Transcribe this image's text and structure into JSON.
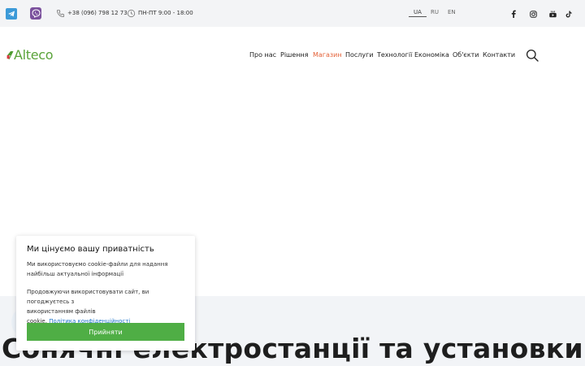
{
  "topbar": {
    "phone": "+38 (096) 798 12 73",
    "hours": "ПН-ПТ 9:00 - 18:00",
    "languages": [
      {
        "code": "UA",
        "active": true
      },
      {
        "code": "RU",
        "active": false
      },
      {
        "code": "EN",
        "active": false
      }
    ],
    "icons": {
      "messengers": [
        "telegram-icon",
        "viber-icon"
      ],
      "info": [
        "phone-icon",
        "clock-icon"
      ],
      "social": [
        "facebook-icon",
        "instagram-icon",
        "youtube-icon",
        "tiktok-icon"
      ]
    }
  },
  "header": {
    "logo_text": "Alteco",
    "nav": [
      {
        "label": "Про нас",
        "active": false
      },
      {
        "label": "Рішення",
        "active": false
      },
      {
        "label": "Магазин",
        "active": true
      },
      {
        "label": "Послуги",
        "active": false
      },
      {
        "label": "Технології",
        "active": false
      },
      {
        "label": "Економіка",
        "active": false
      },
      {
        "label": "Об'єкти",
        "active": false
      },
      {
        "label": "Контакти",
        "active": false
      }
    ],
    "search_icon": "search-icon"
  },
  "hero": {
    "title": "Сонячні електростанції та установки"
  },
  "cookie": {
    "title": "Ми цінуємо вашу приватність",
    "text1_line1": "Ми використовуємо cookie-файли для надання",
    "text1_line2": "найбільш актуальної інформації",
    "text2_line1": "Продовжуючи використовувати сайт, ви погоджуєтесь з",
    "text2_line2": "використанням файлів",
    "text2_line3_prefix": "cookie.",
    "link": "Політика конфіденційності",
    "accept_label": "Прийняти"
  },
  "colors": {
    "brand_green": "#4fae45",
    "active_nav": "#e4633a",
    "topbar_bg": "#f3f4f6",
    "link_blue": "#1a73c9"
  }
}
